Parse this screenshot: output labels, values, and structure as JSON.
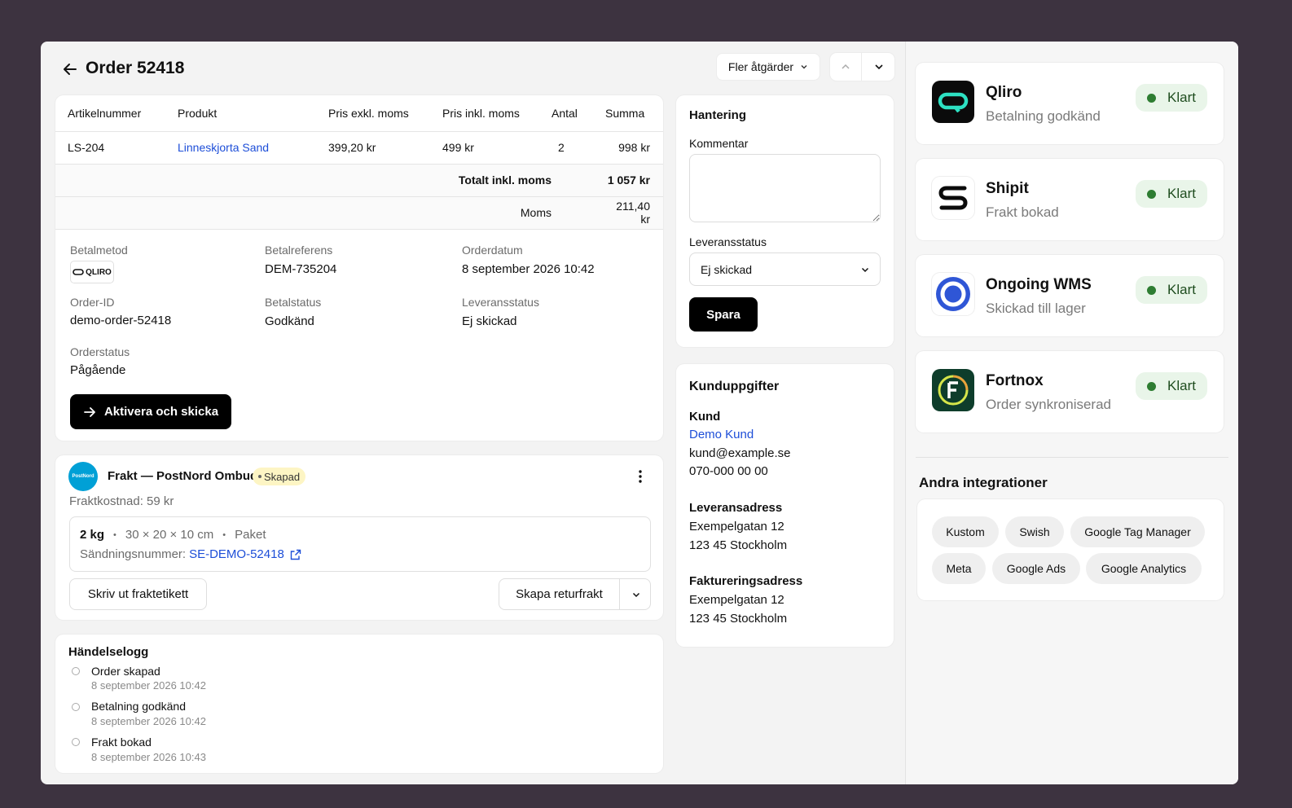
{
  "header": {
    "title": "Order 52418",
    "more_actions": "Fler åtgärder"
  },
  "table": {
    "columns": [
      "Artikelnummer",
      "Produkt",
      "Pris exkl. moms",
      "Pris inkl. moms",
      "Antal",
      "Summa"
    ],
    "rows": [
      {
        "sku": "LS-204",
        "product": "Linneskjorta Sand",
        "price_ex": "399,20 kr",
        "price_inc": "499 kr",
        "qty": "2",
        "sum": "998 kr"
      }
    ],
    "total_label": "Totalt inkl. moms",
    "total_value": "1 057 kr",
    "vat_label": "Moms",
    "vat_value": "211,40 kr"
  },
  "details": {
    "payment_method_label": "Betalmetod",
    "payment_method_logo": "QLIRO",
    "payment_ref_label": "Betalreferens",
    "payment_ref_value": "DEM-735204",
    "order_date_label": "Orderdatum",
    "order_date_value": "8 september 2026 10:42",
    "order_id_label": "Order-ID",
    "order_id_value": "demo-order-52418",
    "payment_status_label": "Betalstatus",
    "payment_status_value": "Godkänd",
    "delivery_status_label": "Leveransstatus",
    "delivery_status_value": "Ej skickad",
    "order_status_label": "Orderstatus",
    "order_status_value": "Pågående",
    "activate_button": "Aktivera och skicka"
  },
  "shipping": {
    "carrier_logo": "PostNord",
    "title": "Frakt — PostNord Ombud",
    "badge": "Skapad",
    "cost": "Fraktkostnad: 59 kr",
    "weight": "2 kg",
    "dimensions": "30 × 20 × 10 cm",
    "package_type": "Paket",
    "tracking_label": "Sändningsnummer:",
    "tracking_number": "SE-DEMO-52418",
    "print_label_button": "Skriv ut fraktetikett",
    "return_button": "Skapa returfrakt"
  },
  "eventlog": {
    "title": "Händelselogg",
    "events": [
      {
        "title": "Order skapad",
        "time": "8 september 2026 10:42"
      },
      {
        "title": "Betalning godkänd",
        "time": "8 september 2026 10:42"
      },
      {
        "title": "Frakt bokad",
        "time": "8 september 2026 10:43"
      }
    ]
  },
  "handling": {
    "title": "Hantering",
    "comment_label": "Kommentar",
    "comment_value": "",
    "delivery_status_label": "Leveransstatus",
    "delivery_status_selected": "Ej skickad",
    "save_button": "Spara"
  },
  "customer": {
    "title": "Kunduppgifter",
    "customer_label": "Kund",
    "customer_name": "Demo Kund",
    "email": "kund@example.se",
    "phone": "070-000 00 00",
    "delivery_label": "Leveransadress",
    "delivery_street": "Exempelgatan 12",
    "delivery_city": "123 45 Stockholm",
    "billing_label": "Faktureringsadress",
    "billing_street": "Exempelgatan 12",
    "billing_city": "123 45 Stockholm"
  },
  "integrations": [
    {
      "name": "Qliro",
      "status": "Betalning godkänd",
      "badge": "Klart",
      "icon": "qliro-logo-icon"
    },
    {
      "name": "Shipit",
      "status": "Frakt bokad",
      "badge": "Klart",
      "icon": "shipit-logo-icon"
    },
    {
      "name": "Ongoing WMS",
      "status": "Skickad till lager",
      "badge": "Klart",
      "icon": "ongoing-logo-icon"
    },
    {
      "name": "Fortnox",
      "status": "Order synkroniserad",
      "badge": "Klart",
      "icon": "fortnox-logo-icon"
    }
  ],
  "other_integrations": {
    "title": "Andra integrationer",
    "items": [
      "Kustom",
      "Swish",
      "Google Tag Manager",
      "Meta",
      "Google Ads",
      "Google Analytics"
    ]
  },
  "colors": {
    "background": "#3d3340",
    "link": "#1d4ed8",
    "success": "#2e7d32",
    "badge_yellow": "#fdf5c4"
  }
}
